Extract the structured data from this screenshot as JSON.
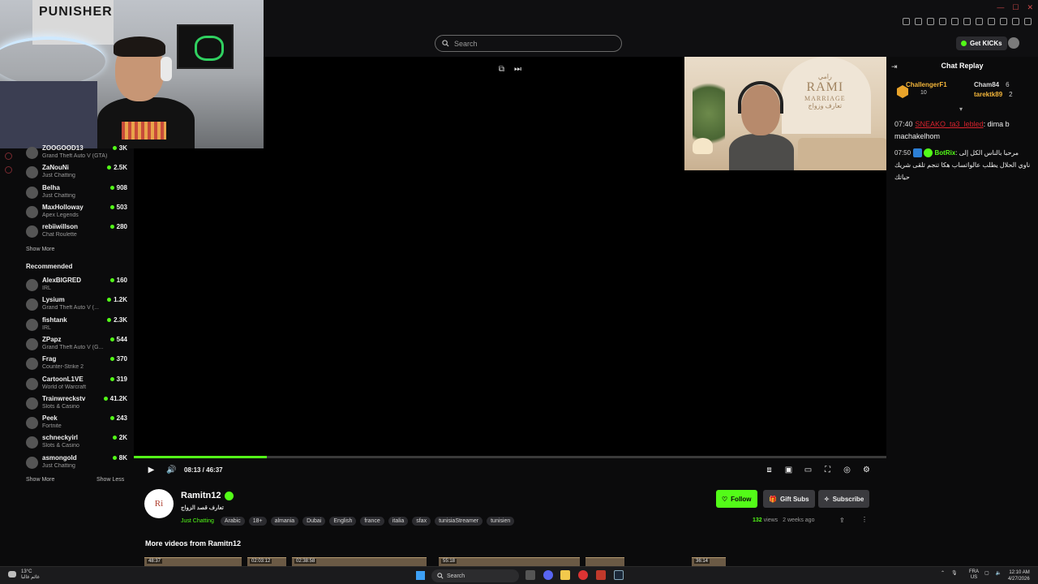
{
  "search": {
    "placeholder": "Search"
  },
  "header": {
    "get_kicks_label": "Get KICKs"
  },
  "sidebar": {
    "following": [
      {
        "name": "ZOOGOOD13",
        "category": "Grand Theft Auto V (GTA)",
        "viewers": "3K"
      },
      {
        "name": "ZaNouNi",
        "category": "Just Chatting",
        "viewers": "2.5K"
      },
      {
        "name": "Belha",
        "category": "Just Chatting",
        "viewers": "908"
      },
      {
        "name": "MaxHolloway",
        "category": "Apex Legends",
        "viewers": "503"
      },
      {
        "name": "rebiiwillson",
        "category": "Chat Roulette",
        "viewers": "280"
      }
    ],
    "show_more_label": "Show More",
    "recommended_title": "Recommended",
    "recommended": [
      {
        "name": "AlexBIGRED",
        "category": "IRL",
        "viewers": "160"
      },
      {
        "name": "Lysium",
        "category": "Grand Theft Auto V (...",
        "viewers": "1.2K"
      },
      {
        "name": "fishtank",
        "category": "IRL",
        "viewers": "2.3K"
      },
      {
        "name": "ZPapz",
        "category": "Grand Theft Auto V (G...",
        "viewers": "544"
      },
      {
        "name": "Frag",
        "category": "Counter-Strike 2",
        "viewers": "370"
      },
      {
        "name": "CartoonL1VE",
        "category": "World of Warcraft",
        "viewers": "319"
      },
      {
        "name": "Trainwreckstv",
        "category": "Slots & Casino",
        "viewers": "41.2K"
      },
      {
        "name": "Peek",
        "category": "Fortnite",
        "viewers": "243"
      },
      {
        "name": "schneckyirl",
        "category": "Slots & Casino",
        "viewers": "2K"
      },
      {
        "name": "asmongold",
        "category": "Just Chatting",
        "viewers": "8K"
      }
    ],
    "show_more_label_2": "Show More",
    "show_less_label": "Show Less"
  },
  "webcam": {
    "poster_text": "PUNISHER"
  },
  "facecam": {
    "brand_arabic_top": "رامي",
    "brand_name": "RAMI",
    "brand_sub": "MARRIAGE",
    "brand_arabic_bottom": "تعارف وزواج"
  },
  "player": {
    "time": "08:13 / 46:37",
    "progress": 0.177
  },
  "channel": {
    "name": "Ramitn12",
    "subtitle": "تعارف قصد الزواج",
    "category": "Just Chatting",
    "tags": [
      "Arabic",
      "18+",
      "almania",
      "Dubai",
      "English",
      "france",
      "italia",
      "sfax",
      "tunisiaStreamer",
      "tunisien"
    ],
    "follow_label": "Follow",
    "gift_label": "Gift Subs",
    "subscribe_label": "Subscribe",
    "views_count": "132",
    "views_label": "views",
    "age": "2 weeks ago"
  },
  "more_videos_title": "More videos from Ramitn12",
  "thumbnails": [
    "48:37",
    "02:03:12",
    "02:38:58",
    "55:18",
    "",
    "36:14"
  ],
  "chat": {
    "title": "Chat Replay",
    "gifters": {
      "top_name": "ChallengerF1",
      "top_count": "10",
      "list": [
        {
          "name": "Cham84",
          "count": "6"
        },
        {
          "name": "tarektk89",
          "count": "2"
        }
      ]
    },
    "messages": [
      {
        "time": "07:40",
        "user": "SNEAKO_ta3_lebled",
        "text": "dima b machakelhom"
      },
      {
        "time": "07:50",
        "user": "BotRix",
        "text": "مرحبا بالناس الكل إلى ناوي الحلال يطلب عالواتساب هكا تنجم تلقى شريك حياتك"
      }
    ]
  },
  "taskbar": {
    "weather_temp": "13°C",
    "weather_text": "غائم غالبا",
    "search_label": "Search",
    "lang_top": "FRA",
    "lang_bottom": "US",
    "time": "12:10 AM",
    "date": "4/27/2026"
  },
  "colors": {
    "accent": "#53fc18",
    "bg": "#0b0b0c"
  }
}
